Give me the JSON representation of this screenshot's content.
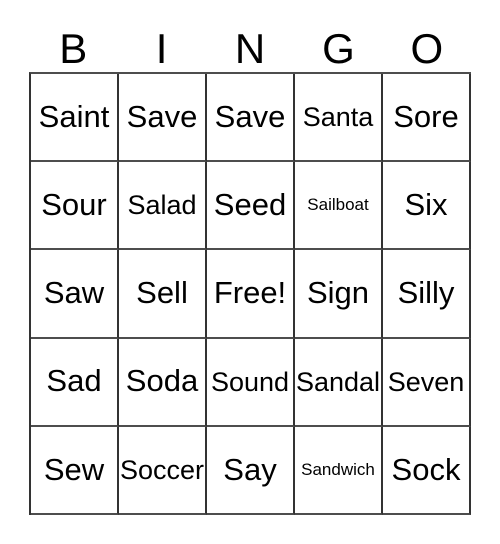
{
  "card": {
    "type": "bingo-card",
    "header_letters": [
      "B",
      "I",
      "N",
      "G",
      "O"
    ],
    "columns": 5,
    "rows": 5,
    "border_color": "#333333",
    "background_color": "#ffffff",
    "text_color": "#000000",
    "free_space_label": "Free!",
    "free_space_position": {
      "row": 3,
      "column": 3
    },
    "cells": [
      [
        {
          "label": "Saint",
          "size": "lg"
        },
        {
          "label": "Save",
          "size": "lg"
        },
        {
          "label": "Save",
          "size": "lg"
        },
        {
          "label": "Santa",
          "size": "md"
        },
        {
          "label": "Sore",
          "size": "lg"
        }
      ],
      [
        {
          "label": "Sour",
          "size": "lg"
        },
        {
          "label": "Salad",
          "size": "md"
        },
        {
          "label": "Seed",
          "size": "lg"
        },
        {
          "label": "Sailboat",
          "size": "xs"
        },
        {
          "label": "Six",
          "size": "lg"
        }
      ],
      [
        {
          "label": "Saw",
          "size": "lg"
        },
        {
          "label": "Sell",
          "size": "lg"
        },
        {
          "label": "Free!",
          "size": "lg"
        },
        {
          "label": "Sign",
          "size": "lg"
        },
        {
          "label": "Silly",
          "size": "lg"
        }
      ],
      [
        {
          "label": "Sad",
          "size": "lg"
        },
        {
          "label": "Soda",
          "size": "lg"
        },
        {
          "label": "Sound",
          "size": "md"
        },
        {
          "label": "Sandal",
          "size": "md"
        },
        {
          "label": "Seven",
          "size": "md"
        }
      ],
      [
        {
          "label": "Sew",
          "size": "lg"
        },
        {
          "label": "Soccer",
          "size": "md"
        },
        {
          "label": "Say",
          "size": "lg"
        },
        {
          "label": "Sandwich",
          "size": "xs"
        },
        {
          "label": "Sock",
          "size": "lg"
        }
      ]
    ]
  }
}
